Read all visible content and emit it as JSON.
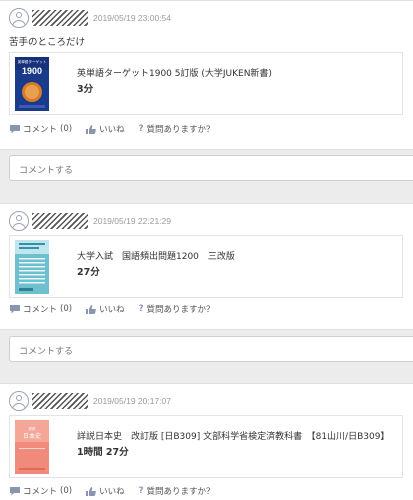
{
  "posts": [
    {
      "timestamp": "2019/05/19 23:00:54",
      "note": "苦手のところだけ",
      "book_title": "英単語ターゲット1900 5訂版 (大学JUKEN新書)",
      "duration": "3分",
      "cover_text": "英単語ターゲット",
      "cover_number": "1900",
      "cover_color": "#1a3b8c"
    },
    {
      "timestamp": "2019/05/19 22:21:29",
      "note": "",
      "book_title": "大学入試　国語頻出問題1200　三改版",
      "duration": "27分",
      "cover_color": "#6fc0cf"
    },
    {
      "timestamp": "2019/05/19 20:17:07",
      "note": "",
      "book_title": "詳説日本史　改訂版 [日B309] 文部科学省検定済教科書　【81山川/日B309】",
      "duration": "1時間 27分",
      "cover_text": "日本史",
      "cover_color": "#f08a7a"
    }
  ],
  "actions": {
    "comment_label": "コメント",
    "comment_count": "(0)",
    "like_label": "いいね",
    "question_label": "質問ありますか？"
  },
  "comment_box": {
    "placeholder": "コメントする"
  },
  "colors": {
    "background": "#ececec",
    "icon_gray": "#8a96b0",
    "timestamp": "#9a9a9a"
  }
}
